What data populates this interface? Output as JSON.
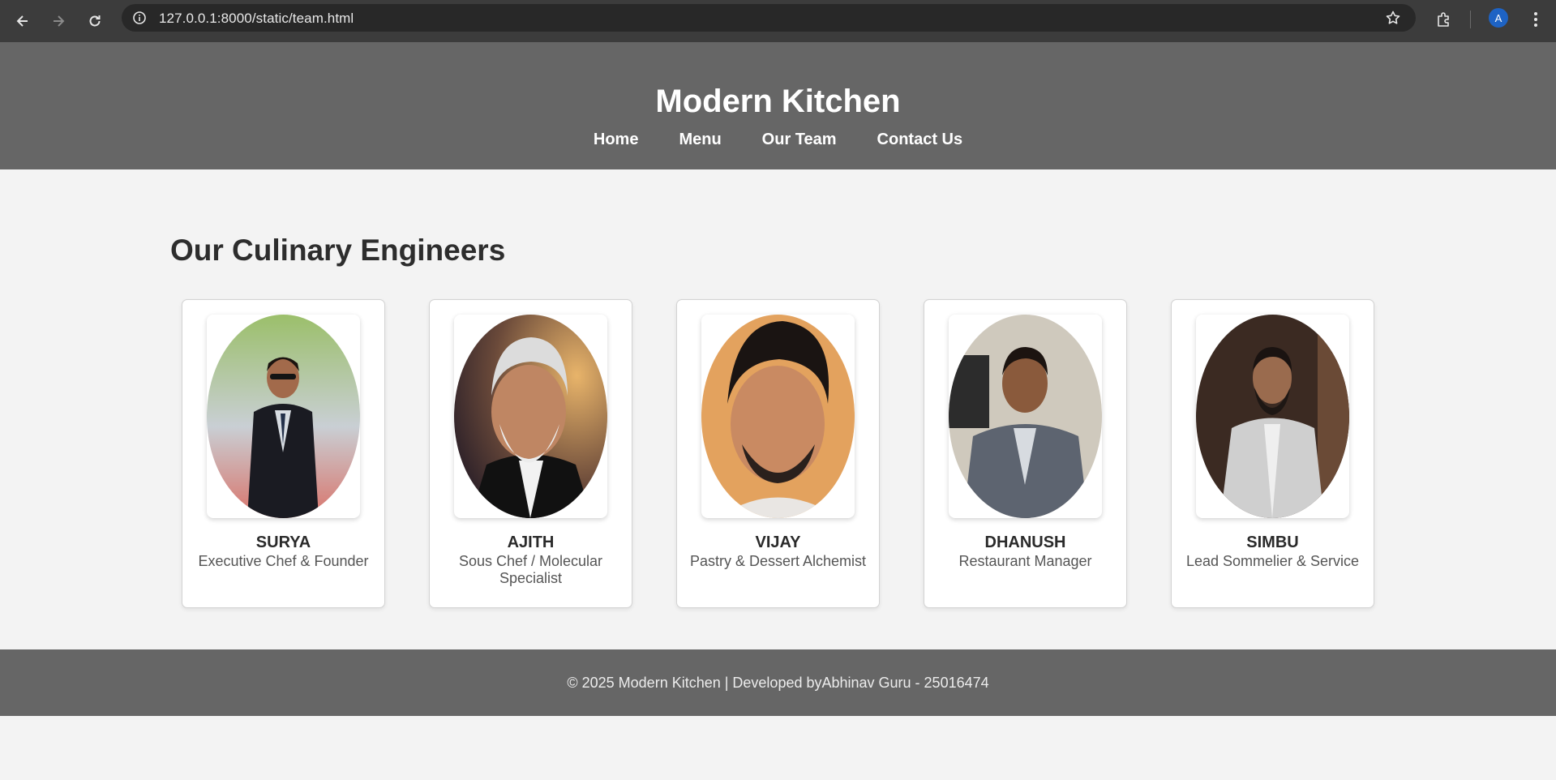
{
  "browser": {
    "url": "127.0.0.1:8000/static/team.html",
    "profile_initial": "A",
    "icons": [
      "back-icon",
      "forward-icon",
      "reload-icon",
      "info-icon",
      "star-icon",
      "extensions-icon",
      "menu-icon"
    ]
  },
  "header": {
    "title": "Modern Kitchen",
    "nav": [
      "Home",
      "Menu",
      "Our Team",
      "Contact Us"
    ]
  },
  "main": {
    "heading": "Our Culinary Engineers",
    "team": [
      {
        "name": "SURYA",
        "role": "Executive Chef & Founder"
      },
      {
        "name": "AJITH",
        "role": "Sous Chef / Molecular Specialist"
      },
      {
        "name": "VIJAY",
        "role": "Pastry & Dessert Alchemist"
      },
      {
        "name": "DHANUSH",
        "role": "Restaurant Manager"
      },
      {
        "name": "SIMBU",
        "role": "Lead Sommelier & Service"
      }
    ]
  },
  "footer": {
    "text": "© 2025 Modern Kitchen | Developed byAbhinav Guru - 25016474"
  },
  "colors": {
    "header_bg": "#666666",
    "page_bg": "#f3f3f3",
    "card_bg": "#ffffff",
    "chrome_bg": "#3c3c3c"
  }
}
